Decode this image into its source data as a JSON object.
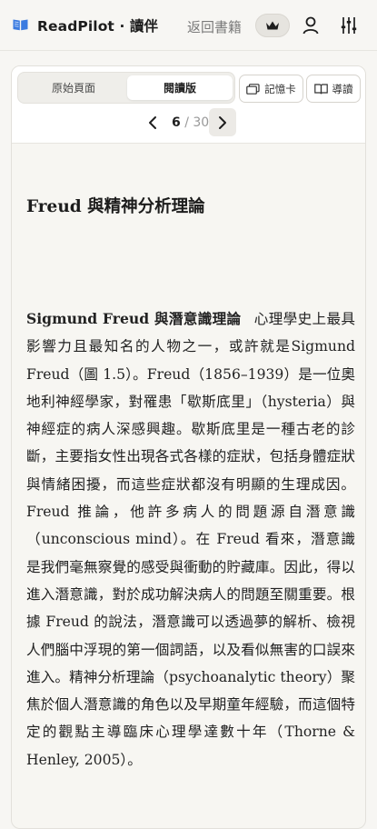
{
  "header": {
    "brand": "ReadPilot · 讀伴",
    "back_label": "返回書籍",
    "icons": {
      "logo": "open-book-icon",
      "crown": "crown-icon",
      "user": "user-icon",
      "settings": "sliders-icon"
    },
    "accent_color": "#2f6fd6"
  },
  "toolbar": {
    "view_modes": [
      {
        "label": "原始頁面",
        "selected": false
      },
      {
        "label": "閱讀版",
        "selected": true
      }
    ],
    "memo_label": "記憶卡",
    "guide_label": "導讀",
    "pager": {
      "current": "6",
      "separator": " / ",
      "total": "30"
    }
  },
  "content": {
    "heading": "Freud 與精神分析理論",
    "lead": "Sigmund Freud 與潛意識理論",
    "paragraph": "心理學史上最具影響力且最知名的人物之一，或許就是Sigmund Freud（圖 1.5）。Freud（1856–1939）是一位奧地利神經學家，對罹患「歇斯底里」（hysteria）與神經症的病人深感興趣。歇斯底里是一種古老的診斷，主要指女性出現各式各樣的症狀，包括身體症狀與情緒困擾，而這些症狀都沒有明顯的生理成因。Freud 推論，他許多病人的問題源自潛意識（unconscious mind）。在 Freud 看來，潛意識是我們毫無察覺的感受與衝動的貯藏庫。因此，得以進入潛意識，對於成功解決病人的問題至關重要。根據 Freud 的說法，潛意識可以透過夢的解析、檢視人們腦中浮現的第一個詞語，以及看似無害的口誤來進入。精神分析理論（psychoanalytic theory）聚焦於個人潛意識的角色以及早期童年經驗，而這個特定的觀點主導臨床心理學達數十年（Thorne & Henley, 2005）。"
  }
}
